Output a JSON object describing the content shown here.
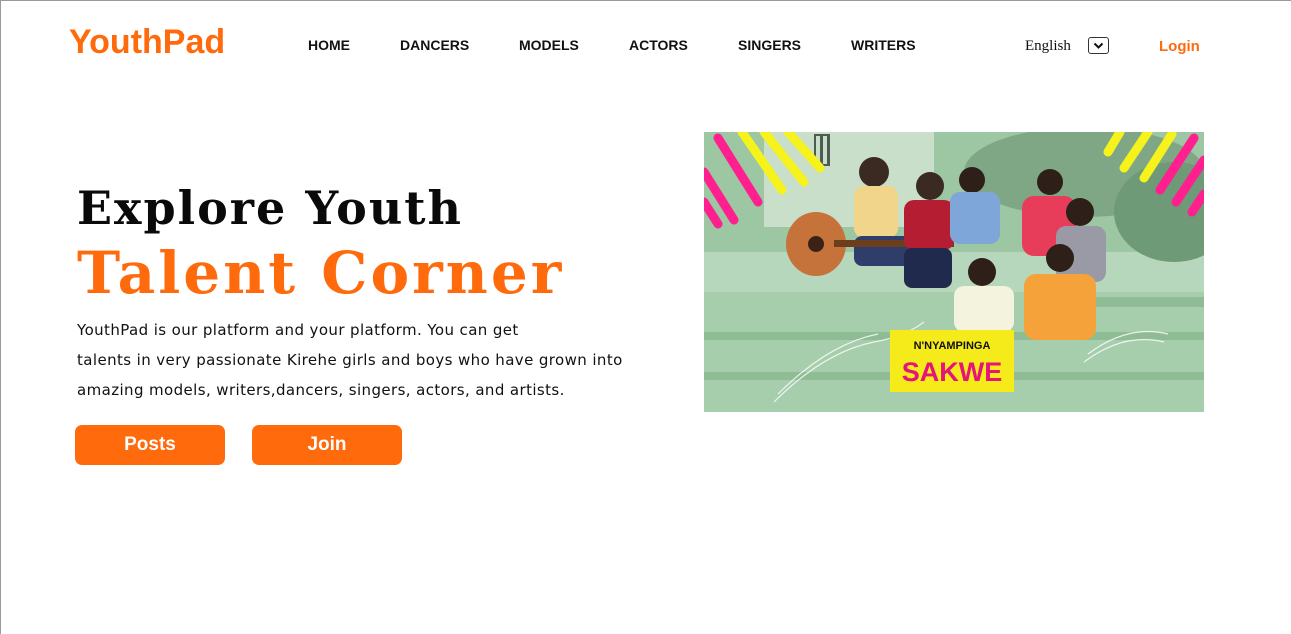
{
  "brand": {
    "name": "YouthPad",
    "accent_color": "#ff6a0c"
  },
  "nav": {
    "items": [
      {
        "label": "HOME"
      },
      {
        "label": "DANCERS"
      },
      {
        "label": "MODELS"
      },
      {
        "label": "ACTORS"
      },
      {
        "label": "SINGERS"
      },
      {
        "label": "WRITERS"
      }
    ]
  },
  "language": {
    "selected": "English",
    "icon": "chevron-down-icon"
  },
  "auth": {
    "login_label": "Login"
  },
  "hero": {
    "title_line1": "Explore Youth",
    "title_line2": "Talent Corner",
    "description_lines": [
      "YouthPad is our platform and your platform. You can get",
      "talents in very passionate Kirehe girls and boys who have grown into",
      "amazing models, writers,dancers, singers, actors, and artists."
    ],
    "buttons": {
      "posts_label": "Posts",
      "join_label": "Join"
    },
    "image": {
      "description": "photo-of-youth-group-singing-with-guitar",
      "badge_line1": "N'NYAMPINGA",
      "badge_line2": "SAKWE"
    }
  }
}
